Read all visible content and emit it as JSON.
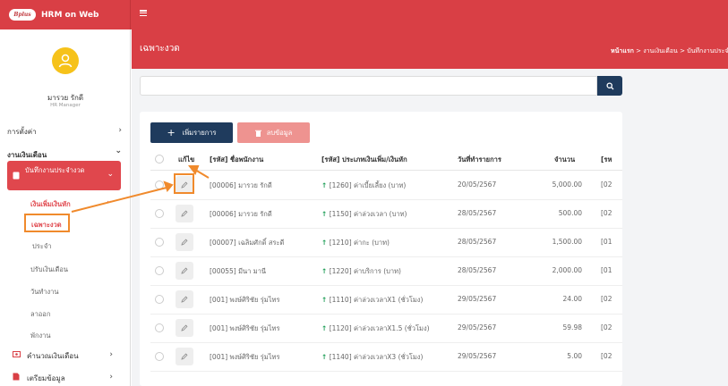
{
  "app": {
    "title": "HRM on Web",
    "logo_text": "Bplus"
  },
  "user": {
    "name": "มารวย รักดี",
    "role": "HR Manager"
  },
  "sidebar": {
    "settings": "การตั้งค่า",
    "payroll": "งานเงินเดือน",
    "record_payroll": "บันทึกงานประจำงวด",
    "income_deduction": "เงินเพิ่มเงินหัก",
    "special": "เฉพาะงวด",
    "regular": "ประจำ",
    "salary_adjust": "ปรับเงินเดือน",
    "workday": "วันทำงาน",
    "leave": "ลาออก",
    "suspend": "พักงาน",
    "calc_salary": "คำนวณเงินเดือน",
    "prepare_data": "เตรียมข้อมูล"
  },
  "page": {
    "title": "เฉพาะงวด",
    "breadcrumb": {
      "home": "หน้าแรก",
      "sep": ">",
      "b2": "งานเงินเดือน",
      "b3": "บันทึกงานประจำงวด"
    }
  },
  "toolbar": {
    "add_label": "เพิ่มรายการ",
    "delete_label": "ลบข้อมูล"
  },
  "table": {
    "headers": {
      "edit": "แก้ไข",
      "employee": "[รหัส] ชื่อพนักงาน",
      "type": "[รหัส] ประเภทเงินเพิ่ม/เงินหัก",
      "date": "วันที่ทำรายการ",
      "amount": "จำนวน",
      "code": "[รห"
    },
    "rows": [
      {
        "employee": "[00006] มารวย รักดี",
        "type": "[1260] ค่าเบี้ยเลี้ยง (บาท)",
        "date": "20/05/2567",
        "amount": "5,000.00",
        "code": "[02"
      },
      {
        "employee": "[00006] มารวย รักดี",
        "type": "[1150] ค่าล่วงเวลา (บาท)",
        "date": "28/05/2567",
        "amount": "500.00",
        "code": "[02"
      },
      {
        "employee": "[00007] เฉลิมศักดิ์ สระดี",
        "type": "[1210] ค่ากะ (บาท)",
        "date": "28/05/2567",
        "amount": "1,500.00",
        "code": "[01"
      },
      {
        "employee": "[00055] มีนา มานี",
        "type": "[1220] ค่าบริการ (บาท)",
        "date": "28/05/2567",
        "amount": "2,000.00",
        "code": "[01"
      },
      {
        "employee": "[001] พงษ์ศิริชัย รุ่มไทร",
        "type": "[1110] ค่าล่วงเวลาX1 (ชั่วโมง)",
        "date": "29/05/2567",
        "amount": "24.00",
        "code": "[02"
      },
      {
        "employee": "[001] พงษ์ศิริชัย รุ่มไทร",
        "type": "[1120] ค่าล่วงเวลาX1.5 (ชั่วโมง)",
        "date": "29/05/2567",
        "amount": "59.98",
        "code": "[02"
      },
      {
        "employee": "[001] พงษ์ศิริชัย รุ่มไทร",
        "type": "[1140] ค่าล่วงเวลาX3 (ชั่วโมง)",
        "date": "29/05/2567",
        "amount": "5.00",
        "code": "[02"
      }
    ]
  },
  "icons": {
    "up_arrow": "↑",
    "chevron_right": "›",
    "chevron_down": "⌄",
    "plus": "+",
    "trash": "🗑",
    "search": "⌕"
  },
  "colors": {
    "brand_red": "#d93f45",
    "navy": "#1f3b5d",
    "accent_orange": "#f08a2c",
    "avatar_yellow": "#f6c21a",
    "income_green": "#1e9e57"
  }
}
